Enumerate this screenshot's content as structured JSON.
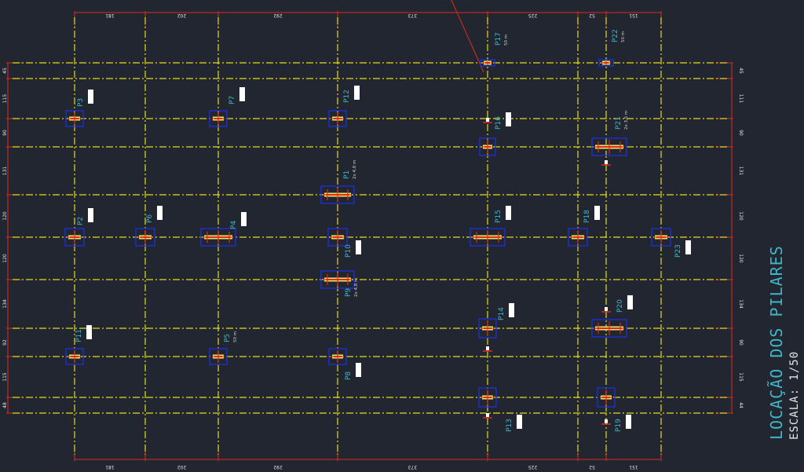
{
  "title": "LOCAÇÃO DOS PILARES",
  "scale": "ESCALA: 1/50",
  "colors": {
    "background": "#212630",
    "grid_line": "#e3dc1a",
    "dimension_line": "#e02a1a",
    "pillar_frame": "#1f2fd0",
    "pillar_body": "#e9e26a",
    "pillar_core": "#e02a1a",
    "label": "#3fb6c8"
  },
  "column_dimensions_top": [
    "181",
    "202",
    "292",
    "373",
    "225",
    "52",
    "151"
  ],
  "column_dimensions_bottom": [
    "181",
    "202",
    "292",
    "373",
    "225",
    "52",
    "151"
  ],
  "row_dimensions_left": [
    "45",
    "115",
    "90",
    "131",
    "120",
    "120",
    "134",
    "92",
    "115",
    "48"
  ],
  "row_dimensions_right": [
    "45",
    "111",
    "90",
    "131",
    "120",
    "120",
    "134",
    "90",
    "115",
    "44"
  ],
  "pillars": [
    {
      "id": "P1",
      "label": "P1",
      "note": "2x 4,8 m"
    },
    {
      "id": "P2",
      "label": "P2",
      "note": ""
    },
    {
      "id": "P3",
      "label": "P3",
      "note": ""
    },
    {
      "id": "P4",
      "label": "P4",
      "note": ""
    },
    {
      "id": "P5",
      "label": "P5",
      "note": "50 m"
    },
    {
      "id": "P6",
      "label": "P6",
      "note": ""
    },
    {
      "id": "P7",
      "label": "P7",
      "note": ""
    },
    {
      "id": "P8",
      "label": "P8",
      "note": ""
    },
    {
      "id": "P9",
      "label": "P9",
      "note": "2x 4,8 m"
    },
    {
      "id": "P10",
      "label": "P10",
      "note": ""
    },
    {
      "id": "P11",
      "label": "P11",
      "note": ""
    },
    {
      "id": "P12",
      "label": "P12",
      "note": ""
    },
    {
      "id": "P13",
      "label": "P13",
      "note": ""
    },
    {
      "id": "P14",
      "label": "P14",
      "note": ""
    },
    {
      "id": "P15",
      "label": "P15",
      "note": ""
    },
    {
      "id": "P16",
      "label": "P16",
      "note": ""
    },
    {
      "id": "P17",
      "label": "P17",
      "note": "50 m"
    },
    {
      "id": "P18",
      "label": "P18",
      "note": ""
    },
    {
      "id": "P19",
      "label": "P19",
      "note": ""
    },
    {
      "id": "P20",
      "label": "P20",
      "note": ""
    },
    {
      "id": "P21",
      "label": "P21",
      "note": "2x 3,5 m"
    },
    {
      "id": "P22",
      "label": "P22",
      "note": "50 m"
    },
    {
      "id": "P23",
      "label": "P23",
      "note": ""
    }
  ]
}
